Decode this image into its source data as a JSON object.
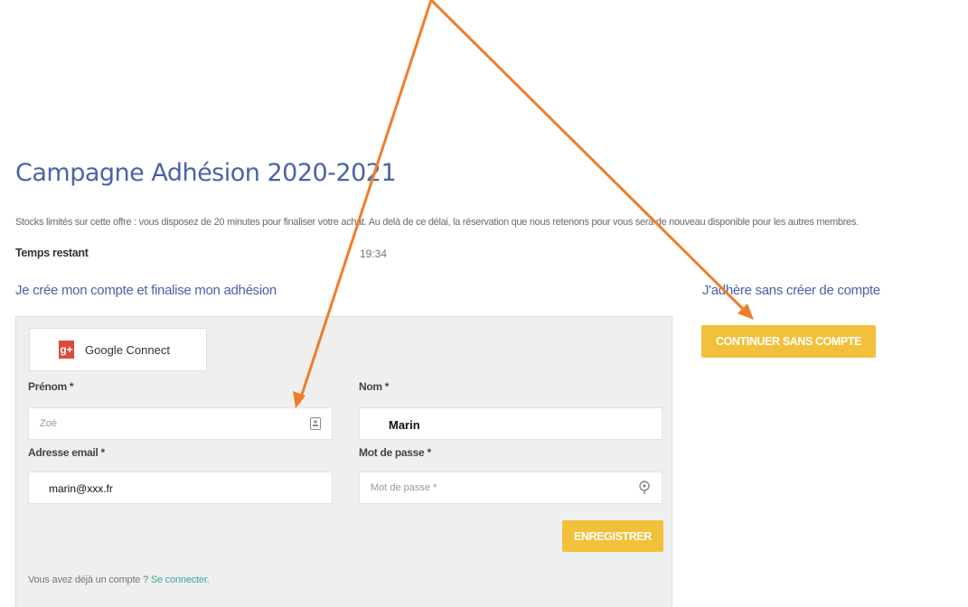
{
  "page": {
    "title": "Campagne Adhésion 2020-2021",
    "intro": "Stocks limités sur cette offre : vous disposez de 20 minutes pour finaliser votre achat. Au delà de ce délai, la réservation que nous retenons pour vous sera de nouveau disponible pour les autres membres.",
    "timer_label": "Temps restant",
    "timer_value": "19:34"
  },
  "left_section": {
    "heading": "Je crée mon compte et finalise mon adhésion",
    "google_icon": "g+",
    "google_label": "Google Connect",
    "prenom_label": "Prénom *",
    "prenom_value": "Zoé",
    "nom_label": "Nom *",
    "nom_value": "Marin",
    "email_label": "Adresse email *",
    "email_value": "marin@xxx.fr",
    "password_label": "Mot de passe *",
    "password_placeholder": "Mot de passe *",
    "register_button": "Enregistrer",
    "already_text": "Vous avez déjà un compte ?",
    "login_link": "Se connecter."
  },
  "right_section": {
    "heading": "J'adhère sans créer de compte",
    "continue_button": "Continuer sans compte"
  },
  "icons": {
    "prenom_field_icon": "contact-card-icon",
    "password_field_icon": "key-icon",
    "google_icon": "google-plus-icon"
  },
  "colors": {
    "heading": "#4a63a8",
    "button": "#f3c03b",
    "link": "#3aa8a0",
    "panel": "#efefef",
    "annotation_arrow": "#ef7d2b",
    "google": "#dd4b39"
  }
}
